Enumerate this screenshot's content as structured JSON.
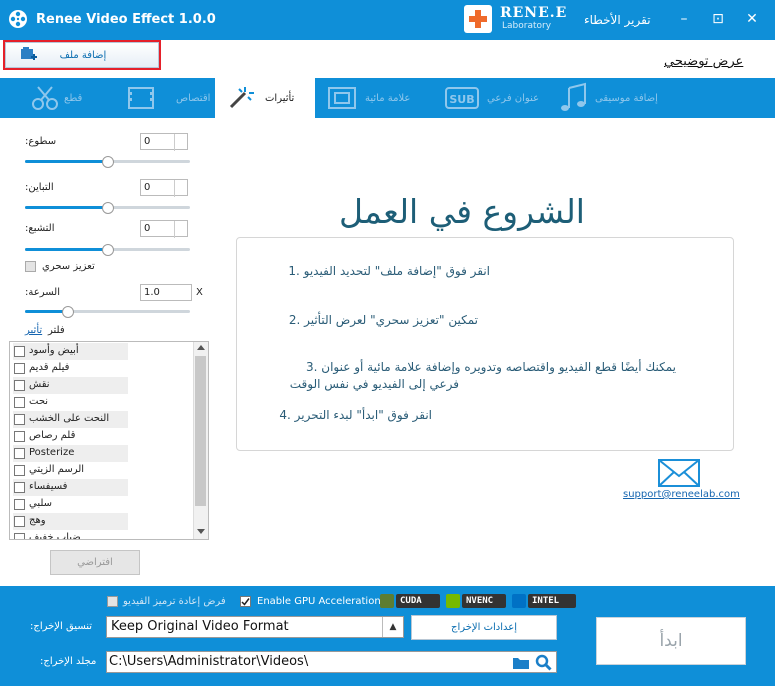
{
  "titlebar": {
    "app_title": "Renee Video Effect 1.0.0",
    "brand_name": "RENE.E",
    "brand_sub": "Laboratory",
    "bug_report": "تقرير الأخطاء",
    "min_glyph": "–",
    "restore_glyph": "⊡",
    "close_glyph": "✕",
    "colors": {
      "bar": "#0f8fd8",
      "text": "#ffffff"
    }
  },
  "toolbar": {
    "add_file_label": "إضافة ملف",
    "demo_link": "عرض توضيحي"
  },
  "tabs": [
    {
      "label": "قطع",
      "icon": "cut-icon",
      "active": false
    },
    {
      "label": "اقتصاص",
      "icon": "crop-icon",
      "active": false
    },
    {
      "label": "تأثيرات",
      "icon": "magic-wand-icon",
      "active": true
    },
    {
      "label": "علامة مائية",
      "icon": "watermark-icon",
      "active": false
    },
    {
      "label": "عنوان فرعي",
      "icon": "subtitle-icon",
      "active": false
    },
    {
      "label": "إضافة موسيقى",
      "icon": "music-icon",
      "active": false
    }
  ],
  "effects": {
    "brightness": {
      "label": ":سطوع",
      "value": "0",
      "level": 0.5
    },
    "contrast": {
      "label": ":التباين",
      "value": "0",
      "level": 0.5
    },
    "saturation": {
      "label": ":التشبع",
      "value": "0",
      "level": 0.5
    },
    "magic_enhance": {
      "label": "تعزيز سحري",
      "checked": false
    },
    "speed": {
      "label": ":السرعة",
      "value": "1.0",
      "suffix": "X",
      "level": 0.25
    },
    "filter_label": "فلتر",
    "effect_link": "تأثير",
    "filters": [
      "أبيض وأسود",
      "فيلم قديم",
      "نقش",
      "نحت",
      "النحت على الخشب",
      "قلم رصاص",
      "Posterize",
      "الرسم الزيتي",
      "فسيفساء",
      "سلبي",
      "وهج",
      "ضباب خفيف"
    ],
    "default_button": "افتراضي"
  },
  "main": {
    "title": "الشروع في العمل",
    "steps": [
      "انقر فوق \"إضافة ملف\" لتحديد الفيديو .1",
      "تمكين \"تعزيز سحري\" لعرض التأثير .2",
      "يمكنك أيضًا قطع الفيديو واقتصاصه وتدويره وإضافة علامة مائية أو عنوان .3",
      "فرعي إلى الفيديو في نفس الوقت",
      "انقر فوق \"ابدأ\" لبدء التحرير .4"
    ],
    "support_email": "support@reneelab.com",
    "colors": {
      "title": "#1d5e77",
      "steps": "#2a5c77"
    }
  },
  "bottom": {
    "reencode_label": "فرض إعادة ترميز الفيديو",
    "reencode_checked": false,
    "gpu_label": "Enable GPU Acceleration",
    "gpu_checked": true,
    "chips": [
      "CUDA",
      "NVENC",
      "INTEL"
    ],
    "format_label": ":تنسيق الإخراج",
    "format_value": "Keep Original Video Format",
    "output_settings": "إعدادات الإخراج",
    "folder_label": ":مجلد الإخراج",
    "folder_value": "C:\\Users\\Administrator\\Videos\\",
    "start_button": "ابدأ"
  }
}
